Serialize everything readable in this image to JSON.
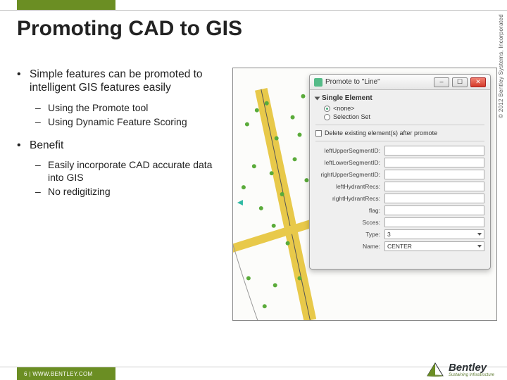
{
  "accent_color": "#6b8e23",
  "title": "Promoting CAD to GIS",
  "copyright": "© 2012 Bentley Systems, Incorporated",
  "bullets": {
    "b1": "Simple features can be promoted to intelligent GIS features easily",
    "b1_sub": {
      "s1": "Using the Promote tool",
      "s2": "Using Dynamic Feature Scoring"
    },
    "b2": "Benefit",
    "b2_sub": {
      "s1": "Easily incorporate CAD accurate data into GIS",
      "s2": "No redigitizing"
    }
  },
  "dialog": {
    "title": "Promote to \"Line\"",
    "section": "Single Element",
    "radio_none": "<none>",
    "radio_sel": "Selection Set",
    "checkbox": "Delete existing element(s) after promote",
    "fields": {
      "leftUpper": {
        "label": "leftUpperSegmentID:",
        "value": ""
      },
      "leftLower": {
        "label": "leftLowerSegmentID:",
        "value": ""
      },
      "rightUpper": {
        "label": "rightUpperSegmentID:",
        "value": ""
      },
      "leftHydrant": {
        "label": "leftHydrantRecs:",
        "value": ""
      },
      "rightHydrant": {
        "label": "rightHydrantRecs:",
        "value": ""
      },
      "flag": {
        "label": "flag:",
        "value": ""
      },
      "scces": {
        "label": "Scces:",
        "value": ""
      },
      "type": {
        "label": "Type:",
        "value": "3"
      },
      "name": {
        "label": "Name:",
        "value": "CENTER"
      }
    }
  },
  "footer": {
    "page": "6",
    "sep": " | ",
    "url": "WWW.BENTLEY.COM"
  },
  "logo": {
    "brand": "Bentley",
    "tagline": "Sustaining Infrastructure"
  }
}
